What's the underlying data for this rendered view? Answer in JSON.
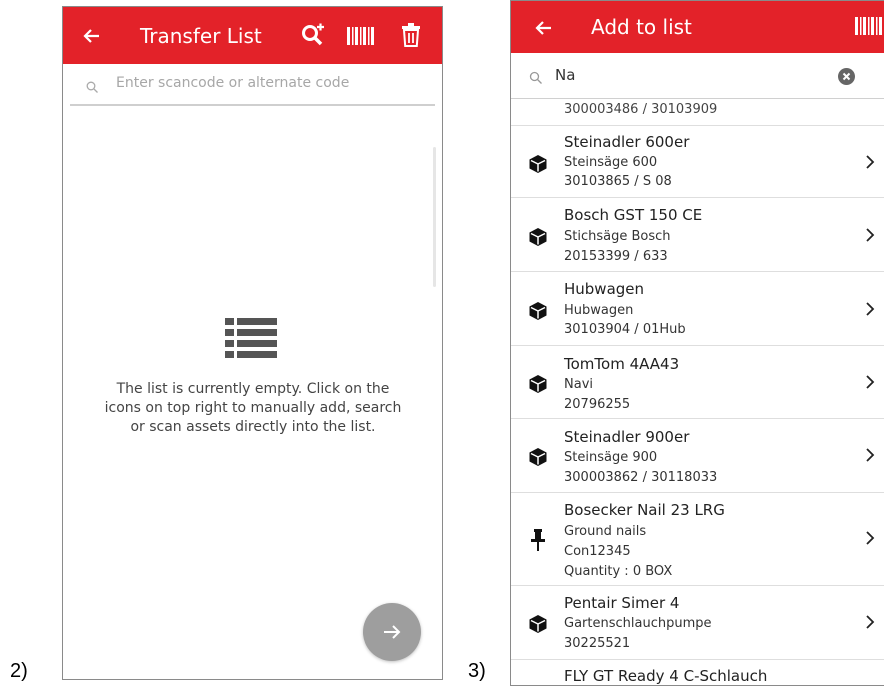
{
  "figure_labels": {
    "left": "2)",
    "right": "3)"
  },
  "transfer_screen": {
    "title": "Transfer List",
    "search_placeholder": "Enter scancode or alternate code",
    "empty_message": "The list is currently empty. Click on the\nicons on top right to manually add, search\nor scan assets directly into the list.",
    "icons": [
      "back-arrow-icon",
      "search-plus-icon",
      "barcode-icon",
      "trash-icon",
      "list-icon",
      "arrow-right-icon"
    ],
    "accent_color": "#e32229",
    "fab_color": "#9e9e9e"
  },
  "add_screen": {
    "title": "Add to list",
    "search_value": "Na",
    "partial_top": "300003486 / 30103909",
    "items": [
      {
        "name": "Steinadler 600er",
        "lines": [
          "Steinsäge 600",
          "30103865 / S 08"
        ],
        "icon": "box-icon"
      },
      {
        "name": "Bosch GST 150 CE",
        "lines": [
          "Stichsäge Bosch",
          "20153399 / 633"
        ],
        "icon": "box-icon"
      },
      {
        "name": "Hubwagen",
        "lines": [
          "Hubwagen",
          "30103904 / 01Hub"
        ],
        "icon": "box-icon"
      },
      {
        "name": "TomTom 4AA43",
        "lines": [
          "Navi",
          "20796255"
        ],
        "icon": "box-icon"
      },
      {
        "name": "Steinadler 900er",
        "lines": [
          "Steinsäge 900",
          "300003862 / 30118033"
        ],
        "icon": "box-icon"
      },
      {
        "name": "Bosecker Nail 23 LRG",
        "lines": [
          "Ground nails",
          "Con12345",
          "Quantity : 0 BOX"
        ],
        "icon": "pin-icon"
      },
      {
        "name": "Pentair Simer 4",
        "lines": [
          "Gartenschlauchpumpe",
          "30225521"
        ],
        "icon": "box-icon"
      }
    ],
    "partial_bottom": "FLY GT Ready 4 C-Schlauch"
  }
}
